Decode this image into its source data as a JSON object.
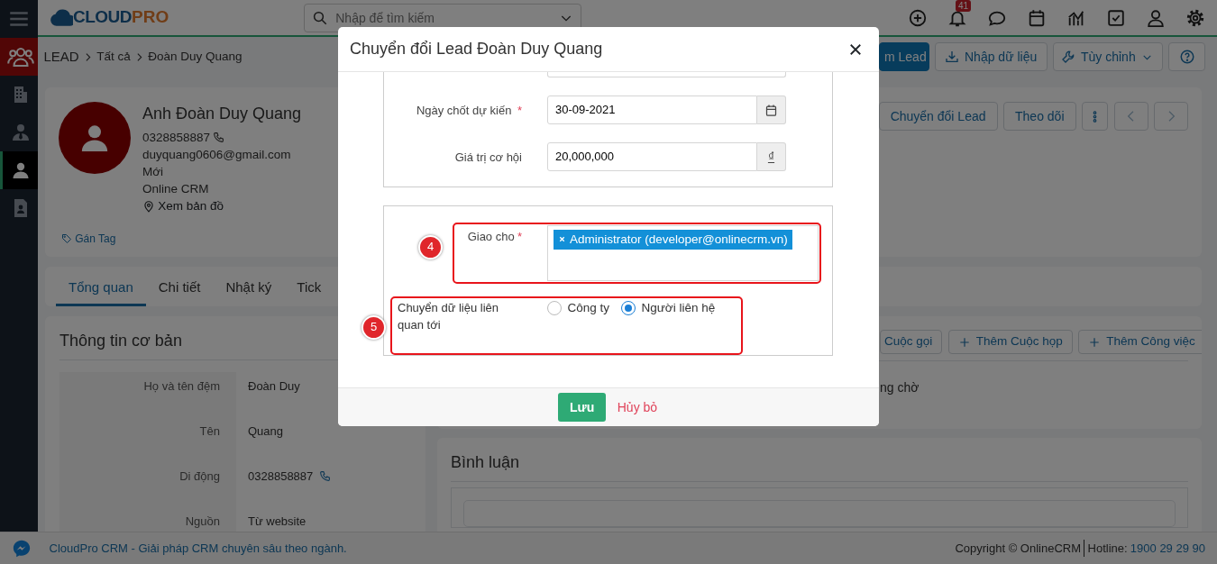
{
  "sidebar": {
    "items": [
      {
        "module": true,
        "selected": false
      },
      {
        "module": false,
        "selected": false
      },
      {
        "module": false,
        "selected": false
      },
      {
        "module": false,
        "selected": true
      },
      {
        "module": false,
        "selected": false
      }
    ]
  },
  "topbar": {
    "logo": [
      {
        "text": "CLOUD"
      },
      {
        "text": "PRO"
      }
    ],
    "search": {
      "placeholder": "Nhập để tìm kiếm"
    },
    "notifications": "41"
  },
  "breadcrumb": [
    "LEAD",
    "Tất cả",
    "Đoàn Duy Quang"
  ],
  "header_buttons": [
    {
      "kind": "primary",
      "label": "m Lead"
    },
    {
      "kind": "import",
      "label": "Nhập dữ liệu"
    },
    {
      "kind": "dropdown",
      "label": "Tùy chỉnh"
    },
    {
      "kind": "help"
    }
  ],
  "profile": {
    "name": "Anh Đoàn Duy Quang",
    "phone": "0328858887",
    "email": "duyquang0606@gmail.com",
    "status": "Mới",
    "source": "Online CRM",
    "map_link": "Xem bản đồ",
    "tag_link": "Gán Tag",
    "actions": [
      {
        "kind": "text",
        "label": "Chuyển đổi Lead"
      },
      {
        "kind": "text",
        "label": "Theo dõi"
      },
      {
        "kind": "more"
      },
      {
        "kind": "prev",
        "disabled": true
      },
      {
        "kind": "next",
        "disabled": true
      }
    ]
  },
  "tabs": [
    {
      "label": "Tổng quan",
      "selected": true
    },
    {
      "label": "Chi tiết",
      "selected": false
    },
    {
      "label": "Nhật ký",
      "selected": false
    },
    {
      "label": "Tick",
      "selected": false
    }
  ],
  "basic_info": {
    "title": "Thông tin cơ bản",
    "rows": [
      {
        "label": "Họ và tên đệm",
        "value": "Đoàn Duy",
        "phone": false
      },
      {
        "label": "Tên",
        "value": "Quang",
        "phone": false
      },
      {
        "label": "Di động",
        "value": "0328858887",
        "phone": true
      },
      {
        "label": "Nguồn",
        "value": "Từ website",
        "phone": false
      }
    ]
  },
  "activities": {
    "buttons": [
      {
        "label": "Cuộc gọi",
        "plus": false
      },
      {
        "label": "Thêm Cuộc họp",
        "plus": true
      },
      {
        "label": "Thêm Công việc",
        "plus": true
      }
    ],
    "text": "ng chờ"
  },
  "comments": {
    "title": "Bình luận"
  },
  "modal": {
    "title": "Chuyển đổi Lead Đoàn Duy Quang",
    "fields": [
      {
        "kind": "date",
        "label": "Ngày chốt dự kiến",
        "required_mark": "*",
        "value": "30-09-2021"
      },
      {
        "kind": "currency",
        "label": "Giá trị cơ hội",
        "value": "20,000,000",
        "currency": "₫"
      }
    ],
    "assign": {
      "label": "Giao cho",
      "required_mark": "*",
      "tags": [
        "Administrator (developer@onlinecrm.vn)"
      ],
      "callout": "4"
    },
    "transfer": {
      "label": "Chuyển dữ liệu liên quan tới",
      "callout": "5",
      "options": [
        {
          "label": "Công ty",
          "selected": false
        },
        {
          "label": "Người liên hệ",
          "selected": true
        }
      ]
    },
    "buttons": [
      {
        "kind": "save",
        "label": "Lưu"
      },
      {
        "kind": "cancel",
        "label": "Hủy bỏ"
      }
    ]
  },
  "footer": {
    "text": "CloudPro CRM - Giải pháp CRM chuyên sâu theo ngành.",
    "copyright": "Copyright © OnlineCRM",
    "hotline_label": "Hotline:",
    "hotline": "1900 29 29 90"
  }
}
